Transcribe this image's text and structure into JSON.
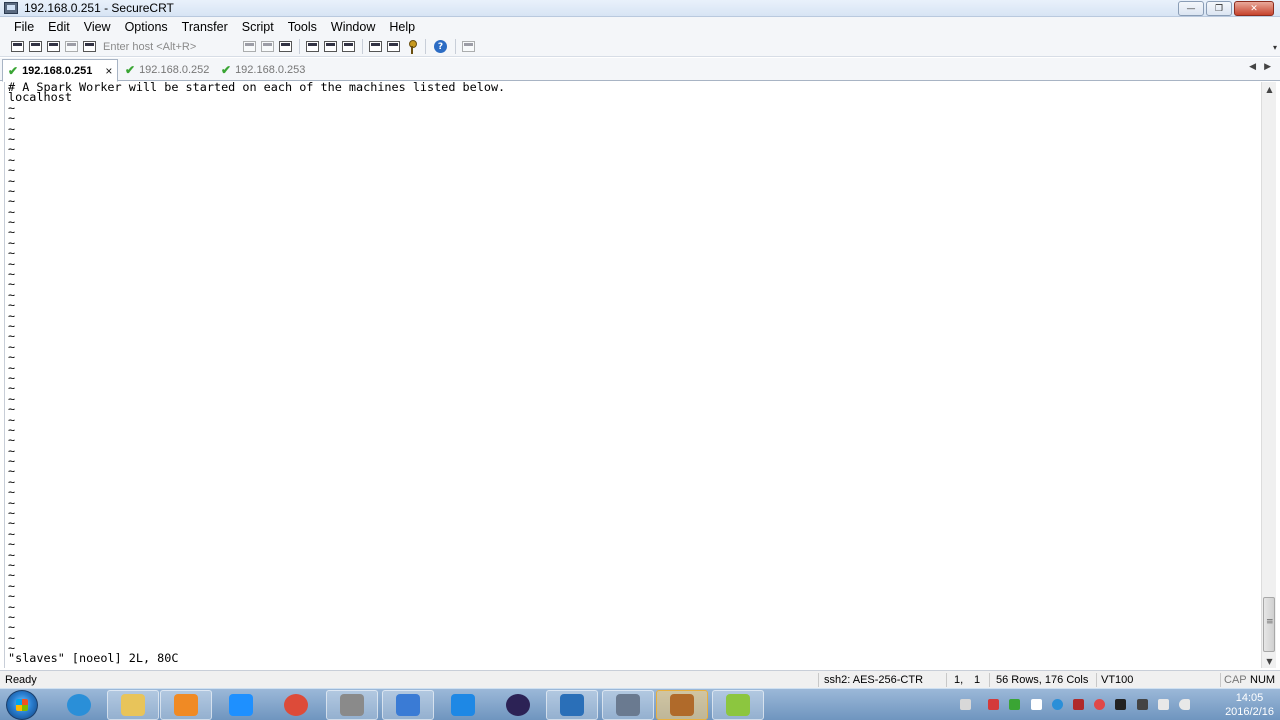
{
  "window": {
    "title": "192.168.0.251 - SecureCRT",
    "buttons": {
      "minimize": "—",
      "maximize": "❐",
      "close": "✕"
    }
  },
  "menu": [
    "File",
    "Edit",
    "View",
    "Options",
    "Transfer",
    "Script",
    "Tools",
    "Window",
    "Help"
  ],
  "toolbar": {
    "host_placeholder": "Enter host <Alt+R>",
    "help_glyph": "?",
    "dropdown_glyph": "▾"
  },
  "tabs": [
    {
      "label": "192.168.0.251",
      "active": true,
      "close": "×"
    },
    {
      "label": "192.168.0.252",
      "active": false
    },
    {
      "label": "192.168.0.253",
      "active": false
    }
  ],
  "tab_nav": {
    "prev": "◀",
    "next": "▶"
  },
  "terminal": {
    "lines": [
      "# A Spark Worker will be started on each of the machines listed below.",
      "localhost"
    ],
    "tilde": "~",
    "tilde_count": 53,
    "status_line": "\"slaves\" [noeol] 2L, 80C"
  },
  "scrollbar": {
    "up": "▲",
    "down": "▼"
  },
  "statusbar": {
    "ready": "Ready",
    "cipher": "ssh2: AES-256-CTR",
    "row": "1,",
    "col": "1",
    "size": "56 Rows, 176 Cols",
    "term": "VT100",
    "cap": "CAP",
    "num": "NUM"
  },
  "taskbar": {
    "apps": [
      {
        "name": "internet-explorer-icon",
        "color": "#2a8fd8"
      },
      {
        "name": "file-explorer-icon",
        "color": "#e8c45a"
      },
      {
        "name": "media-player-icon",
        "color": "#f08a24"
      },
      {
        "name": "cloud-sync-icon",
        "color": "#1e90ff"
      },
      {
        "name": "chrome-icon",
        "color": "#dd4b39"
      },
      {
        "name": "terminal-app-icon",
        "color": "#8a8a8a"
      },
      {
        "name": "network-tool-icon",
        "color": "#3a7bd5"
      },
      {
        "name": "feather-app-icon",
        "color": "#1e88e5"
      },
      {
        "name": "eclipse-icon",
        "color": "#2c2255"
      },
      {
        "name": "virtualbox-icon",
        "color": "#2a6fb8"
      },
      {
        "name": "securecrt-icon",
        "color": "#6a7a90"
      },
      {
        "name": "character-app-icon",
        "color": "#b06a2a"
      },
      {
        "name": "m-app-icon",
        "color": "#8cc63f"
      }
    ],
    "time": "14:05",
    "date": "2016/2/16"
  }
}
